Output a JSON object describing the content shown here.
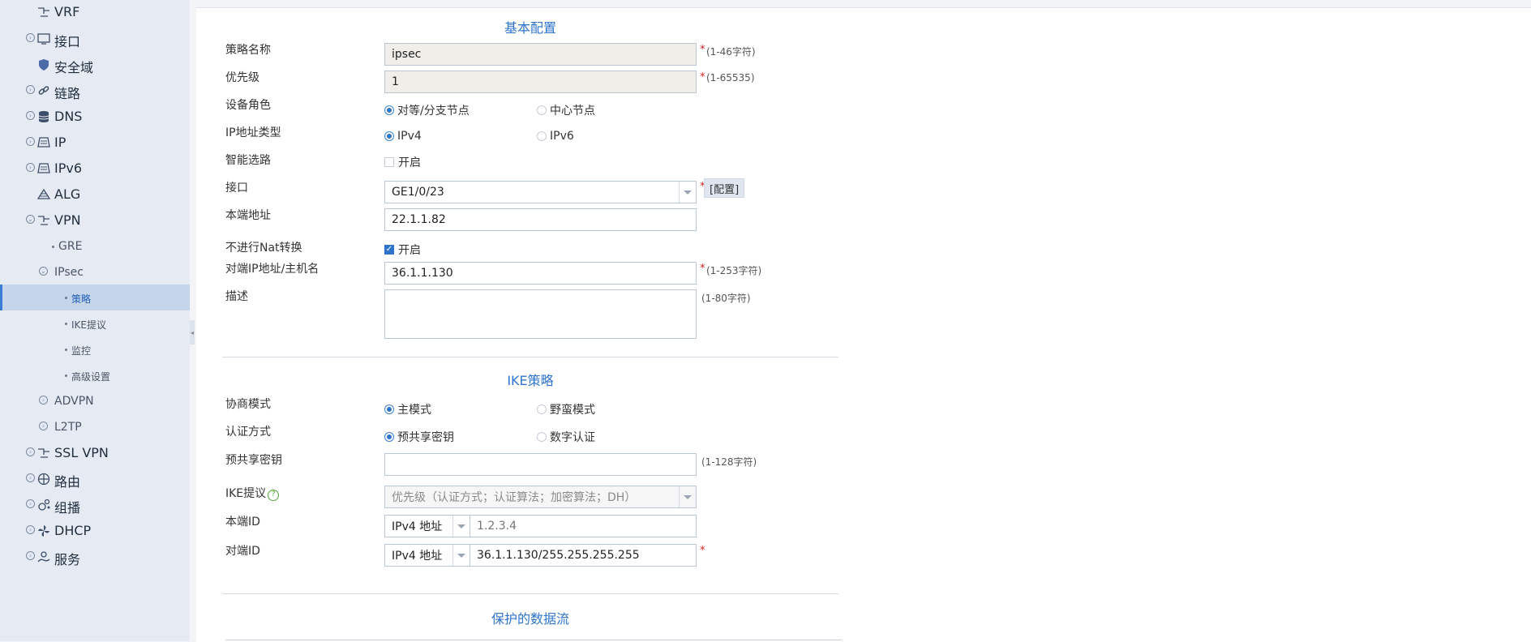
{
  "sidebar": {
    "items": [
      {
        "id": "vrf",
        "label": "VRF",
        "icon": "vrf-icon"
      },
      {
        "id": "interface",
        "label": "接口",
        "icon": "interface-icon"
      },
      {
        "id": "security-zone",
        "label": "安全域",
        "icon": "shield-icon"
      },
      {
        "id": "link",
        "label": "链路",
        "icon": "link-icon"
      },
      {
        "id": "dns",
        "label": "DNS",
        "icon": "database-icon"
      },
      {
        "id": "ip",
        "label": "IP",
        "icon": "ip-icon"
      },
      {
        "id": "ipv6",
        "label": "IPv6",
        "icon": "ipv6-icon"
      },
      {
        "id": "alg",
        "label": "ALG",
        "icon": "alg-icon"
      },
      {
        "id": "vpn",
        "label": "VPN",
        "icon": "vpn-icon"
      },
      {
        "id": "gre",
        "label": "GRE"
      },
      {
        "id": "ipsec",
        "label": "IPsec"
      },
      {
        "id": "policy",
        "label": "策略"
      },
      {
        "id": "ike-proposal",
        "label": "IKE提议"
      },
      {
        "id": "monitor",
        "label": "监控"
      },
      {
        "id": "advanced",
        "label": "高级设置"
      },
      {
        "id": "advpn",
        "label": "ADVPN"
      },
      {
        "id": "l2tp",
        "label": "L2TP"
      },
      {
        "id": "ssl-vpn",
        "label": "SSL VPN",
        "icon": "ssl-vpn-icon"
      },
      {
        "id": "routing",
        "label": "路由",
        "icon": "routing-icon"
      },
      {
        "id": "multicast",
        "label": "组播",
        "icon": "multicast-icon"
      },
      {
        "id": "dhcp",
        "label": "DHCP",
        "icon": "dhcp-icon"
      },
      {
        "id": "service",
        "label": "服务",
        "icon": "service-icon"
      }
    ]
  },
  "basic": {
    "title": "基本配置",
    "policy_name": {
      "label": "策略名称",
      "value": "ipsec",
      "hint": "(1-46字符)"
    },
    "priority": {
      "label": "优先级",
      "value": "1",
      "hint": "(1-65535)"
    },
    "device_role": {
      "label": "设备角色",
      "options": [
        "对等/分支节点",
        "中心节点"
      ],
      "selected": "对等/分支节点"
    },
    "ip_type": {
      "label": "IP地址类型",
      "options": [
        "IPv4",
        "IPv6"
      ],
      "selected": "IPv4"
    },
    "smart_route": {
      "label": "智能选路",
      "option": "开启",
      "checked": false
    },
    "interface": {
      "label": "接口",
      "value": "GE1/0/23",
      "button": "[配置]"
    },
    "local_addr": {
      "label": "本端地址",
      "value": "22.1.1.82"
    },
    "no_nat": {
      "label": "不进行Nat转换",
      "option": "开启",
      "checked": true
    },
    "peer_addr": {
      "label": "对端IP地址/主机名",
      "value": "36.1.1.130",
      "hint": "(1-253字符)"
    },
    "description": {
      "label": "描述",
      "value": "",
      "hint": "(1-80字符)"
    }
  },
  "ike": {
    "title": "IKE策略",
    "mode": {
      "label": "协商模式",
      "options": [
        "主模式",
        "野蛮模式"
      ],
      "selected": "主模式"
    },
    "auth": {
      "label": "认证方式",
      "options": [
        "预共享密钥",
        "数字认证"
      ],
      "selected": "预共享密钥"
    },
    "psk": {
      "label": "预共享密钥",
      "value": "",
      "hint": "(1-128字符)"
    },
    "proposal": {
      "label": "IKE提议",
      "placeholder": "优先级（认证方式；认证算法；加密算法；DH）"
    },
    "local_id": {
      "label": "本端ID",
      "type": "IPv4 地址",
      "placeholder": "1.2.3.4"
    },
    "peer_id": {
      "label": "对端ID",
      "type": "IPv4 地址",
      "value": "36.1.1.130/255.255.255.255"
    }
  },
  "flow": {
    "title": "保护的数据流"
  },
  "required_mark": "*",
  "colors": {
    "accent": "#2f74cc",
    "sidebar_bg": "#e6ebf3",
    "active_bg": "#c5d5ea",
    "required": "#d02020"
  }
}
